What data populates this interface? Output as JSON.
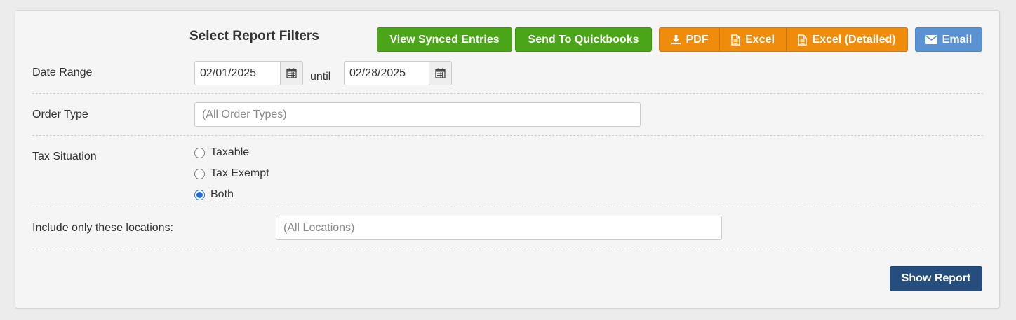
{
  "header": {
    "title": "Select Report Filters",
    "buttons": {
      "view_synced": "View Synced Entries",
      "send_quickbooks": "Send To Quickbooks",
      "pdf": "PDF",
      "excel": "Excel",
      "excel_detailed": "Excel (Detailed)",
      "email": "Email"
    }
  },
  "filters": {
    "date_range": {
      "label": "Date Range",
      "start": "02/01/2025",
      "separator": "until",
      "end": "02/28/2025"
    },
    "order_type": {
      "label": "Order Type",
      "placeholder": "(All Order Types)"
    },
    "tax_situation": {
      "label": "Tax Situation",
      "options": [
        "Taxable",
        "Tax Exempt",
        "Both"
      ],
      "selected": "Both"
    },
    "locations": {
      "label": "Include only these locations:",
      "placeholder": "(All Locations)"
    }
  },
  "footer": {
    "show_report": "Show Report"
  },
  "colors": {
    "green": "#4aa518",
    "orange": "#ef8c0b",
    "email_blue": "#5b93d2",
    "navy": "#254d7e",
    "radio_checked": "#1f6fe5"
  }
}
